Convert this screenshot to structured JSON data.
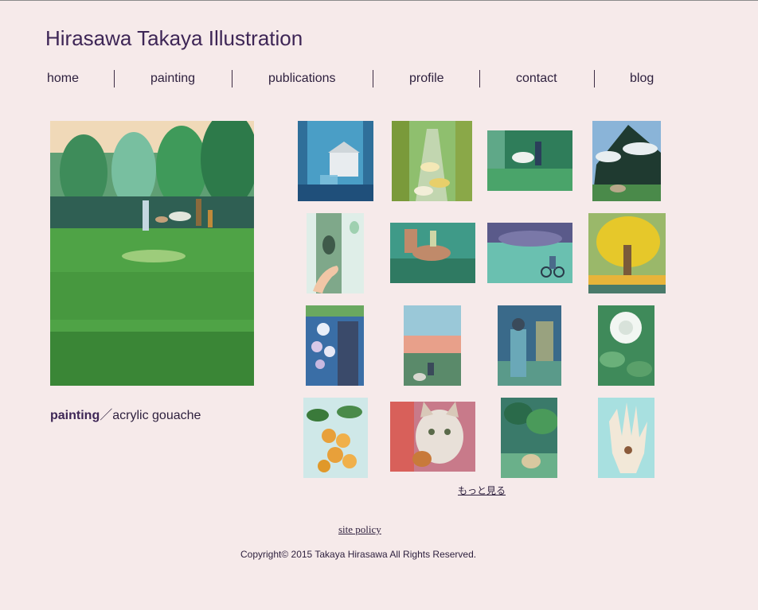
{
  "site": {
    "title": "Hirasawa Takaya Illustration"
  },
  "nav": {
    "items": [
      {
        "label": "home"
      },
      {
        "label": "painting"
      },
      {
        "label": "publications"
      },
      {
        "label": "profile"
      },
      {
        "label": "contact"
      },
      {
        "label": "blog"
      }
    ]
  },
  "featured": {
    "category": "painting",
    "separator": "／",
    "medium": "acrylic gouache"
  },
  "gallery": {
    "more_label": "もっと見る",
    "thumbnails": [
      "window-house",
      "lantern-path",
      "white-dog-forest",
      "deer-tree",
      "hand-tree",
      "horse-rider",
      "cyclist-night",
      "yellow-tree",
      "flowers-person",
      "sunset-field",
      "boy-night",
      "white-rose",
      "loquat-fruit",
      "cat-portrait",
      "bear-forest",
      "open-hand"
    ]
  },
  "footer": {
    "policy_label": "site policy",
    "copyright": "Copyright© 2015 Takaya Hirasawa All Rights Reserved."
  }
}
